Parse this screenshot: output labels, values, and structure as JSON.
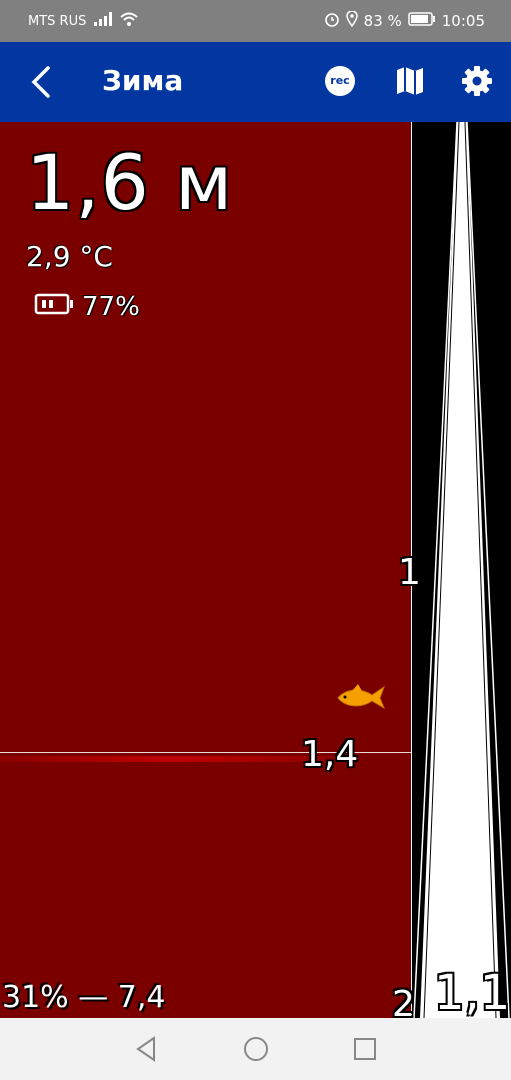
{
  "status": {
    "carrier": "MTS RUS",
    "battery_percent": "83 %",
    "time": "10:05"
  },
  "appbar": {
    "title": "Зима",
    "rec_label": "rec"
  },
  "readout": {
    "depth": "1,6 м",
    "temperature": "2,9 °C",
    "device_battery": "77%"
  },
  "scale": {
    "label_top": "1",
    "label_mid": "1,4",
    "label_bottom": "2"
  },
  "bottom": {
    "stats": "31% — 7,4",
    "value": "1,1"
  },
  "colors": {
    "appbar": "#0236a0",
    "background": "#7a0000",
    "fish": "#f5a000"
  }
}
